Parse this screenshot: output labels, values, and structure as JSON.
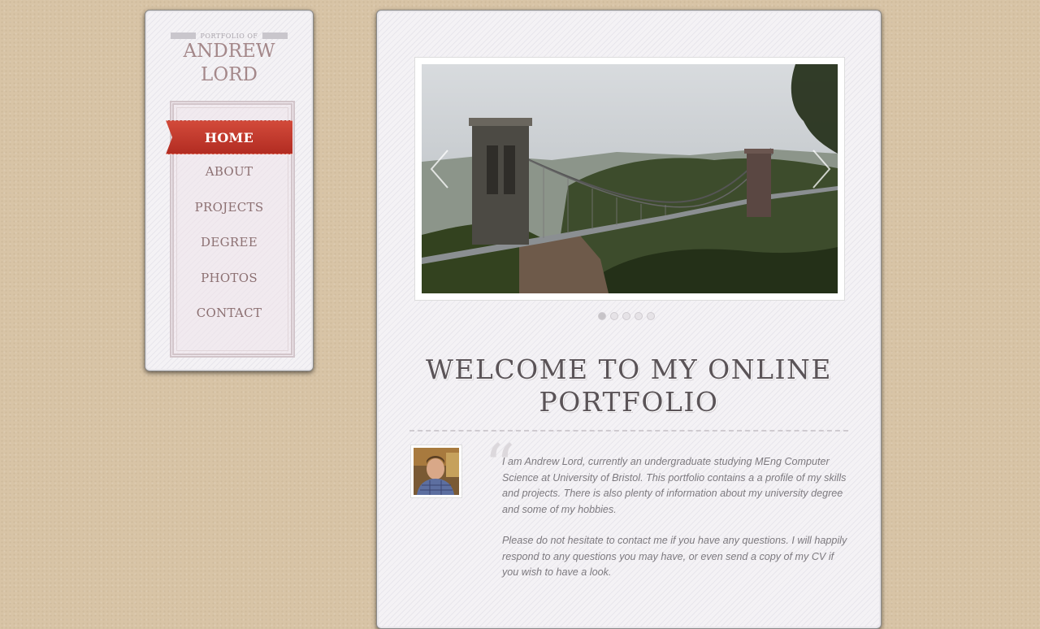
{
  "sidebar": {
    "portfolio_of": "PORTFOLIO OF",
    "name_line1": "ANDREW",
    "name_line2": "LORD",
    "nav": [
      {
        "label": "HOME",
        "active": true
      },
      {
        "label": "ABOUT"
      },
      {
        "label": "PROJECTS"
      },
      {
        "label": "DEGREE"
      },
      {
        "label": "PHOTOS"
      },
      {
        "label": "CONTACT"
      }
    ]
  },
  "slider": {
    "prev_icon": "chevron-left-icon",
    "next_icon": "chevron-right-icon",
    "slide_count": 5,
    "active_slide": 1
  },
  "welcome": {
    "heading_line1": "WELCOME TO MY ONLINE",
    "heading_line2": "PORTFOLIO",
    "quote_mark": "“",
    "paragraph1": "I am Andrew Lord, currently an undergraduate studying MEng Computer Science at University of Bristol. This portfolio contains a a profile of my skills and projects. There is also plenty of information about my university degree and some of my hobbies.",
    "paragraph2": "Please do not hesitate to contact me if you have any questions. I will happily respond to any questions you may have, or even send a copy of my CV if you wish to have a look."
  },
  "colors": {
    "accent_red": "#c03a2d",
    "name_color": "#a4888a",
    "nav_text": "#8c7072",
    "heading": "#5a5357"
  }
}
